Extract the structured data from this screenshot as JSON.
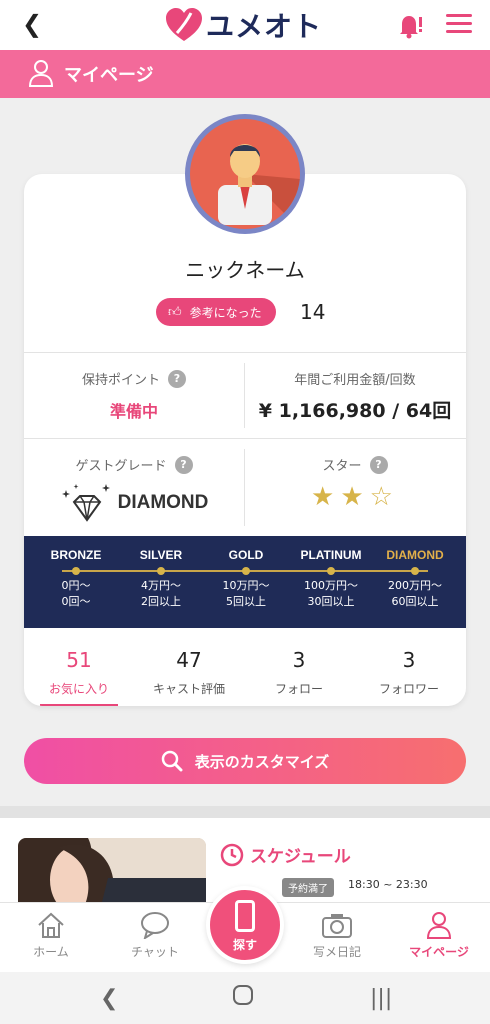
{
  "header": {
    "back_icon": "chevron-left",
    "brand": "ユメオト",
    "brand_color": "#1e2a5a",
    "accent": "#e8477a"
  },
  "page_bar": {
    "title": "マイページ"
  },
  "profile": {
    "nickname": "ニックネーム",
    "helpful_label": "参考になった",
    "helpful_count": "14"
  },
  "points": {
    "label": "保持ポイント",
    "help": "?",
    "value": "準備中"
  },
  "annual": {
    "label": "年間ご利用金額/回数",
    "value": "¥ 1,166,980 / 64回"
  },
  "grade": {
    "label": "ゲストグレード",
    "help": "?",
    "value": "DIAMOND"
  },
  "star": {
    "label": "スター",
    "help": "?",
    "filled": 2,
    "total": 3
  },
  "grades": [
    {
      "name": "BRONZE",
      "amount": "0円〜",
      "count": "0回〜"
    },
    {
      "name": "SILVER",
      "amount": "4万円〜",
      "count": "2回以上"
    },
    {
      "name": "GOLD",
      "amount": "10万円〜",
      "count": "5回以上"
    },
    {
      "name": "PLATINUM",
      "amount": "100万円〜",
      "count": "30回以上"
    },
    {
      "name": "DIAMOND",
      "amount": "200万円〜",
      "count": "60回以上"
    }
  ],
  "stats": [
    {
      "num": "51",
      "label": "お気に入り"
    },
    {
      "num": "47",
      "label": "キャスト評価"
    },
    {
      "num": "3",
      "label": "フォロー"
    },
    {
      "num": "3",
      "label": "フォロワー"
    }
  ],
  "customize_label": "表示のカスタマイズ",
  "schedule": {
    "title": "スケジュール",
    "badge": "予約満了",
    "time": "18:30 ~ 23:30"
  },
  "bottom_nav": {
    "home": "ホーム",
    "chat": "チャット",
    "search": "探す",
    "photo_diary": "写メ日記",
    "mypage": "マイページ"
  }
}
